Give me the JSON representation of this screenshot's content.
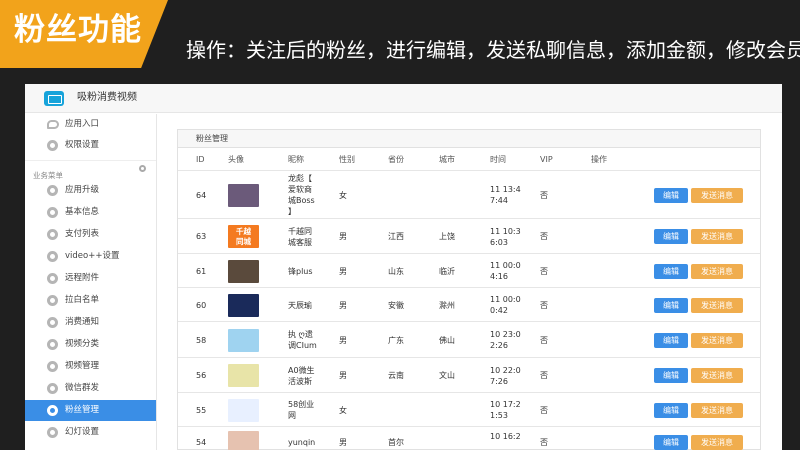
{
  "banner": {
    "title": "粉丝功能"
  },
  "headline": "操作：关注后的粉丝，进行编辑，发送私聊信息，添加金额，修改会员制",
  "app": {
    "title": "吸粉消费视频"
  },
  "sidebar": {
    "top_items": [
      {
        "label": "应用入口",
        "icon": "chat-bubble-icon"
      },
      {
        "label": "权限设置",
        "icon": "gear-icon"
      }
    ],
    "group_label": "业务菜单",
    "items": [
      {
        "label": "应用升级",
        "active": false
      },
      {
        "label": "基本信息",
        "active": false
      },
      {
        "label": "支付列表",
        "active": false
      },
      {
        "label": "video++设置",
        "active": false
      },
      {
        "label": "远程附件",
        "active": false
      },
      {
        "label": "拉白名单",
        "active": false
      },
      {
        "label": "消费通知",
        "active": false
      },
      {
        "label": "视频分类",
        "active": false
      },
      {
        "label": "视频管理",
        "active": false
      },
      {
        "label": "微信群发",
        "active": false
      },
      {
        "label": "粉丝管理",
        "active": true
      },
      {
        "label": "幻灯设置",
        "active": false
      }
    ]
  },
  "panel": {
    "title": "粉丝管理",
    "columns": [
      "ID",
      "头像",
      "昵称",
      "性别",
      "省份",
      "城市",
      "时间",
      "VIP",
      "操作"
    ],
    "edit_label": "编辑",
    "send_label": "发送消息",
    "rows": [
      {
        "id": "64",
        "nickname": [
          "龙彪【",
          "爱软商",
          "城Boss",
          "】"
        ],
        "gender": "女",
        "province": "",
        "city": "",
        "time": [
          "11 13:4",
          "7:44"
        ],
        "vip": "否",
        "avatar_color": "#6b5a7a"
      },
      {
        "id": "63",
        "nickname": [
          "千越同",
          "城客服"
        ],
        "gender": "男",
        "province": "江西",
        "city": "上饶",
        "time": [
          "11 10:3",
          "6:03"
        ],
        "vip": "否",
        "avatar_color": "#f47a20",
        "avatar_text": [
          "千越",
          "同城"
        ]
      },
      {
        "id": "61",
        "nickname": [
          "锋plus"
        ],
        "gender": "男",
        "province": "山东",
        "city": "临沂",
        "time": [
          "11 00:0",
          "4:16"
        ],
        "vip": "否",
        "avatar_color": "#5a4a3c"
      },
      {
        "id": "60",
        "nickname": [
          "天辰瑜"
        ],
        "gender": "男",
        "province": "安徽",
        "city": "滁州",
        "time": [
          "11 00:0",
          "0:42"
        ],
        "vip": "否",
        "avatar_color": "#1a2a5a"
      },
      {
        "id": "58",
        "nickname": [
          "执 ღ遗",
          "调CIum"
        ],
        "gender": "男",
        "province": "广东",
        "city": "佛山",
        "time": [
          "10 23:0",
          "2:26"
        ],
        "vip": "否",
        "avatar_color": "#9fd3f0"
      },
      {
        "id": "56",
        "nickname": [
          "A0微生",
          "活波斯"
        ],
        "gender": "男",
        "province": "云南",
        "city": "文山",
        "time": [
          "10 22:0",
          "7:26"
        ],
        "vip": "否",
        "avatar_color": "#e8e4a8"
      },
      {
        "id": "55",
        "nickname": [
          "58创业",
          "网"
        ],
        "gender": "女",
        "province": "",
        "city": "",
        "time": [
          "10 17:2",
          "1:53"
        ],
        "vip": "否",
        "avatar_color": "#e8f0ff"
      },
      {
        "id": "54",
        "nickname": [
          "yunqin"
        ],
        "gender": "男",
        "province": "首尔",
        "city": "",
        "time": [
          "10 16:2",
          ""
        ],
        "vip": "否",
        "avatar_color": "#e6c2b0"
      }
    ]
  }
}
